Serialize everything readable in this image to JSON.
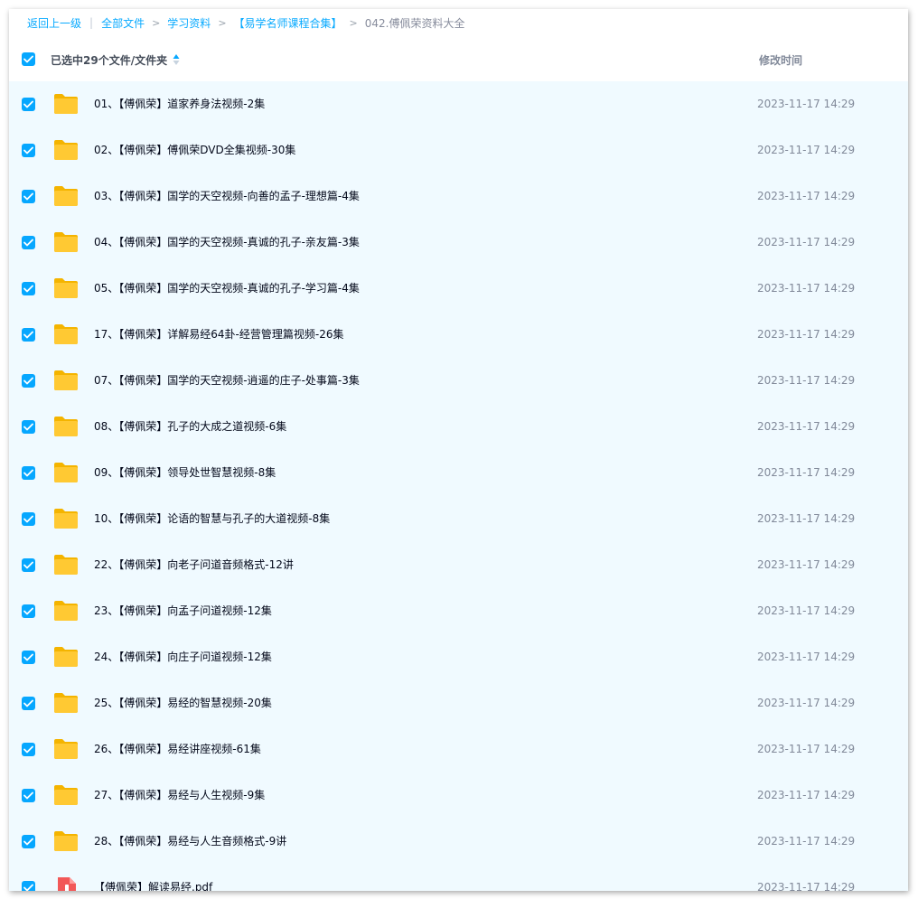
{
  "breadcrumb": {
    "back": "返回上一级",
    "separator": "|",
    "items": [
      "全部文件",
      "学习资料",
      "【易学名师课程合集】"
    ],
    "current": "042.傅佩荣资料大全"
  },
  "header": {
    "selected_label": "已选中29个文件/文件夹",
    "time_label": "修改时间"
  },
  "colors": {
    "accent": "#06a7ff",
    "row_bg": "#f0faff",
    "folder": "#ffc933",
    "pdf": "#f25858"
  },
  "files": [
    {
      "name": "01、【傅佩荣】道家养身法视频-2集",
      "time": "2023-11-17 14:29",
      "type": "folder-icon",
      "checked": true
    },
    {
      "name": "02、【傅佩荣】傅佩荣DVD全集视频-30集",
      "time": "2023-11-17 14:29",
      "type": "folder-icon",
      "checked": true
    },
    {
      "name": "03、【傅佩荣】国学的天空视频-向善的孟子-理想篇-4集",
      "time": "2023-11-17 14:29",
      "type": "folder-icon",
      "checked": true
    },
    {
      "name": "04、【傅佩荣】国学的天空视频-真诚的孔子-亲友篇-3集",
      "time": "2023-11-17 14:29",
      "type": "folder-icon",
      "checked": true
    },
    {
      "name": "05、【傅佩荣】国学的天空视频-真诚的孔子-学习篇-4集",
      "time": "2023-11-17 14:29",
      "type": "folder-icon",
      "checked": true
    },
    {
      "name": "17、【傅佩荣】详解易经64卦-经营管理篇视频-26集",
      "time": "2023-11-17 14:29",
      "type": "folder-icon",
      "checked": true
    },
    {
      "name": "07、【傅佩荣】国学的天空视频-逍遥的庄子-处事篇-3集",
      "time": "2023-11-17 14:29",
      "type": "folder-icon",
      "checked": true
    },
    {
      "name": "08、【傅佩荣】孔子的大成之道视频-6集",
      "time": "2023-11-17 14:29",
      "type": "folder-icon",
      "checked": true
    },
    {
      "name": "09、【傅佩荣】领导处世智慧视频-8集",
      "time": "2023-11-17 14:29",
      "type": "folder-icon",
      "checked": true
    },
    {
      "name": "10、【傅佩荣】论语的智慧与孔子的大道视频-8集",
      "time": "2023-11-17 14:29",
      "type": "folder-icon",
      "checked": true
    },
    {
      "name": "22、【傅佩荣】向老子问道音频格式-12讲",
      "time": "2023-11-17 14:29",
      "type": "folder-icon",
      "checked": true
    },
    {
      "name": "23、【傅佩荣】向孟子问道视频-12集",
      "time": "2023-11-17 14:29",
      "type": "folder-icon",
      "checked": true
    },
    {
      "name": "24、【傅佩荣】向庄子问道视频-12集",
      "time": "2023-11-17 14:29",
      "type": "folder-icon",
      "checked": true
    },
    {
      "name": "25、【傅佩荣】易经的智慧视频-20集",
      "time": "2023-11-17 14:29",
      "type": "folder-icon",
      "checked": true
    },
    {
      "name": "26、【傅佩荣】易经讲座视频-61集",
      "time": "2023-11-17 14:29",
      "type": "folder-icon",
      "checked": true
    },
    {
      "name": "27、【傅佩荣】易经与人生视频-9集",
      "time": "2023-11-17 14:29",
      "type": "folder-icon",
      "checked": true
    },
    {
      "name": "28、【傅佩荣】易经与人生音频格式-9讲",
      "time": "2023-11-17 14:29",
      "type": "folder-icon",
      "checked": true
    },
    {
      "name": "【傅佩荣】解读易经.pdf",
      "time": "2023-11-17 14:29",
      "type": "pdf-icon",
      "checked": true
    }
  ]
}
